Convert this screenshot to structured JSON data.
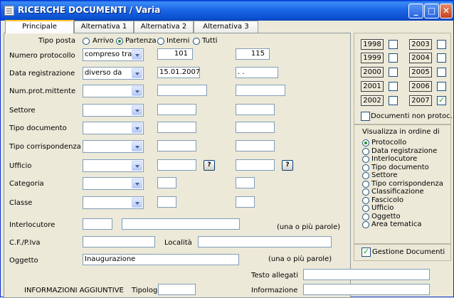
{
  "window": {
    "title": "RICERCHE DOCUMENTI / Varia",
    "minimize": "_",
    "maximize": "□",
    "close": "✕"
  },
  "tabs": [
    "Principale",
    "Alternativa 1",
    "Alternativa 2",
    "Alternativa 3"
  ],
  "tipo_posta": {
    "label": "Tipo posta",
    "options": [
      "Arrivo",
      "Partenza",
      "Interni",
      "Tutti"
    ],
    "selected": "Partenza"
  },
  "rows": {
    "numero_protocollo": {
      "label": "Numero protocollo",
      "operator": "compreso tra",
      "from": "101",
      "to": "115"
    },
    "data_registrazione": {
      "label": "Data registrazione",
      "operator": "diverso da",
      "from": "15.01.2007",
      "to": " .  ."
    },
    "num_prot_mittente": {
      "label": "Num.prot.mittente"
    },
    "settore": {
      "label": "Settore"
    },
    "tipo_documento": {
      "label": "Tipo documento"
    },
    "tipo_corrispondenza": {
      "label": "Tipo corrispondenza"
    },
    "ufficio": {
      "label": "Ufficio",
      "help": "?"
    },
    "categoria": {
      "label": "Categoria"
    },
    "classe": {
      "label": "Classe"
    }
  },
  "interlocutore": {
    "label": "Interlocutore",
    "hint": "(una o più parole)"
  },
  "cf_piva": {
    "label": "C.F./P.Iva",
    "localita_label": "Località"
  },
  "oggetto": {
    "label": "Oggetto",
    "value": "Inaugurazione",
    "hint": "(una o più parole)"
  },
  "testo_allegati": {
    "label": "Testo allegati"
  },
  "informazioni": {
    "label": "INFORMAZIONI AGGIUNTIVE",
    "tipologia_label": "Tipologia",
    "informazione_label": "Informazione"
  },
  "years": [
    {
      "year": "1998",
      "checked": false
    },
    {
      "year": "2003",
      "checked": false
    },
    {
      "year": "1999",
      "checked": false
    },
    {
      "year": "2004",
      "checked": false
    },
    {
      "year": "2000",
      "checked": false
    },
    {
      "year": "2005",
      "checked": false
    },
    {
      "year": "2001",
      "checked": false
    },
    {
      "year": "2006",
      "checked": false
    },
    {
      "year": "2002",
      "checked": false
    },
    {
      "year": "2007",
      "checked": true
    }
  ],
  "documenti_non_protoc": {
    "label": "Documenti non protoc.",
    "checked": false
  },
  "ordine": {
    "title": "Visualizza in ordine di",
    "options": [
      "Protocollo",
      "Data registrazione",
      "Interlocutore",
      "Tipo documento",
      "Settore",
      "Tipo corrispondenza",
      "Classificazione",
      "Fascicolo",
      "Ufficio",
      "Oggetto",
      "Area tematica"
    ],
    "selected": "Protocollo"
  },
  "gestione_documenti": {
    "label": "Gestione Documenti",
    "checked": true
  }
}
